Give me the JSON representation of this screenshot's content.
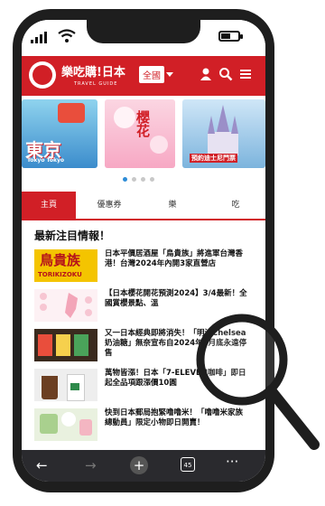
{
  "header": {
    "site_name": "樂吃購!日本",
    "site_sub": "TRAVEL GUIDE",
    "region": "全國"
  },
  "carousel": {
    "slides": [
      {
        "text": "東京",
        "sub": "Tokyo Tokyo"
      },
      {
        "text": "櫻花",
        "sub": ""
      },
      {
        "text": "",
        "sub": "預約迪士尼門票"
      }
    ],
    "dots": 4,
    "active_dot": 0
  },
  "tabs": [
    "主頁",
    "優惠券",
    "樂",
    "吃"
  ],
  "section_title": "最新注目情報！",
  "articles": [
    {
      "title": "日本平價居酒屋「鳥貴族」將進軍台灣香港！台灣2024年內開3家直營店",
      "thumb_text": "鳥貴族",
      "thumb_sub": "TORIKIZOKU"
    },
    {
      "title": "【日本櫻花開花預測2024】3/4最新！全國賞櫻景點、溫"
    },
    {
      "title": "又一日本經典即將消失！「明治Chelsea奶油糖」無奈宣布自2024年3月底永遠停售"
    },
    {
      "title": "萬物皆漲！日本「7-ELEVEN咖啡」即日起全品項跟漲價10圓"
    },
    {
      "title": "快到日本郵局抱緊噜噜米！「噜噜米家族總動員」限定小物即日開賣！"
    }
  ],
  "bottom_nav": {
    "tab_count": "45"
  },
  "colors": {
    "brand": "#d11f26",
    "frame": "#1e1e1e",
    "dot_active": "#2d8cd7"
  }
}
